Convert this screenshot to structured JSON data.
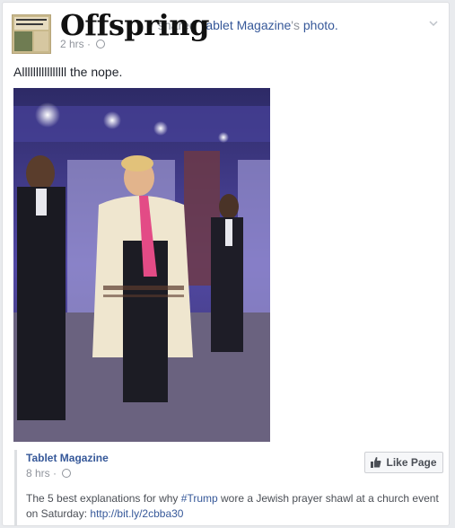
{
  "post": {
    "author_overlay": "Offspring",
    "action_text": "shared",
    "page_link": "Tablet Magazine",
    "possessive": "'s",
    "object": "photo.",
    "time": "2 hrs",
    "status_text": "Allllllllllllllll the nope."
  },
  "shared": {
    "page_name": "Tablet Magazine",
    "time": "8 hrs",
    "like_button": "Like Page",
    "text_before": "The 5 best explanations for why ",
    "hashtag": "#Trump",
    "text_after": " wore a Jewish prayer shawl at a church event on Saturday: ",
    "url": "http://bit.ly/2cbba30"
  },
  "icons": {
    "privacy": "globe-icon",
    "menu": "chevron-down-icon",
    "like": "thumbs-up-icon"
  },
  "colors": {
    "link": "#365899",
    "meta": "#90949c",
    "text": "#1d2129"
  }
}
